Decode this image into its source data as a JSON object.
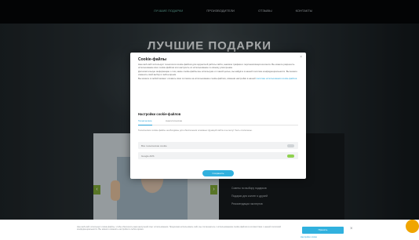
{
  "nav": {
    "items": [
      "ЛУЧШИЕ ПОДАРКИ",
      "ПРОИЗВОДИТЕЛИ",
      "ОТЗЫВЫ",
      "КОНТАКТЫ"
    ]
  },
  "hero": {
    "title": "ЛУЧШИЕ ПОДАРКИ"
  },
  "product": {
    "prev_arrow": "‹",
    "next_arrow": "›",
    "links": [
      "Советы по выбору подарков",
      "Подарки для коллег и друзей",
      "Рекомендации экспертов"
    ]
  },
  "modal": {
    "title": "Cookie-файлы",
    "close": "×",
    "body": [
      "Наш веб-сайт использует технологии cookie-файлов для корректной работы сайта, анализа трафика и персонализации контента. Вы можете разрешить использование всех cookie-файлов или настроить их использование по своему усмотрению.",
      "Дополнительную информацию о том, какие cookie-файлы мы используем и с какой целью, вы найдёте в нашей политике конфиденциальности. Вы можете изменить свой выбор в любое время.",
      "Вы можете в любой момент отозвать своё согласие на использование cookie-файлов, изменив настройки в нашей"
    ],
    "body_link": "политике использования cookie-файлов",
    "settings_title": "Настройки cookie-файлов",
    "tabs": [
      "Технические",
      "Аналитические"
    ],
    "tab_description": "Технические cookie-файлы необходимы для обеспечения основных функций сайта и не могут быть отключены.",
    "rows": [
      {
        "label": "Все технические cookie",
        "toggle_color": "#cfd3d6"
      },
      {
        "label": "Google ADS",
        "toggle_color": "#8fd14f"
      }
    ],
    "save_label": "Сохранить"
  },
  "banner": {
    "text": "Наш веб-сайт использует cookie-файлы, чтобы обеспечить вам наилучший опыт использования. Продолжая использовать сайт, вы соглашаетесь с использованием cookie-файлов в соответствии с нашей политикой конфиденциальности. Вы можете изменить настройки в любое время.",
    "accept_label": "Принять",
    "settings_link": "Настройки cookie",
    "close": "×"
  },
  "colors": {
    "accent": "#31b1de",
    "nav_active": "#66b3a3",
    "arrow": "#7aa235",
    "chat": "#f0a500"
  }
}
